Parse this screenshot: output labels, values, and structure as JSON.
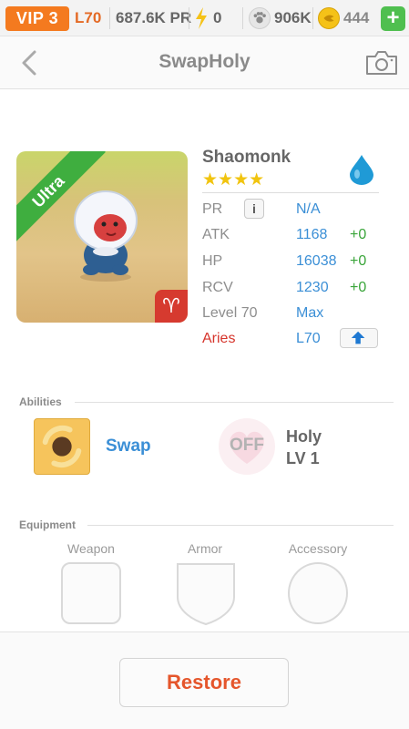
{
  "status": {
    "vip": "VIP 3",
    "level": "L70",
    "pr": "687.6K PR",
    "energy": "0",
    "paws": "906K",
    "coins": "444",
    "add": "+"
  },
  "header": {
    "title": "SwapHoly",
    "back_icon": "chevron-left-icon",
    "camera_icon": "camera-icon"
  },
  "monster": {
    "rarity": "Ultra",
    "name": "Shaomonk",
    "stars": "★★★★",
    "element_icon": "water-drop-icon",
    "zodiac_symbol": "♈",
    "stats": [
      {
        "label": "PR",
        "value": "N/A",
        "bonus": ""
      },
      {
        "label": "ATK",
        "value": "1168",
        "bonus": "+0"
      },
      {
        "label": "HP",
        "value": "16038",
        "bonus": "+0"
      },
      {
        "label": "RCV",
        "value": "1230",
        "bonus": "+0"
      },
      {
        "label": "Level 70",
        "value": "Max",
        "bonus": ""
      },
      {
        "label": "Aries",
        "value": "L70",
        "bonus": ""
      }
    ],
    "info_button": "i"
  },
  "abilities": {
    "title": "Abilities",
    "skill": {
      "name": "Swap"
    },
    "awaken": {
      "state": "OFF",
      "name": "Holy",
      "level": "LV 1"
    }
  },
  "equipment": {
    "title": "Equipment",
    "slots": [
      {
        "label": "Weapon"
      },
      {
        "label": "Armor"
      },
      {
        "label": "Accessory"
      }
    ]
  },
  "actions": {
    "restore": "Restore"
  },
  "colors": {
    "vip": "#f47a1f",
    "accent_blue": "#3b8fd6",
    "bonus_green": "#3aa53a",
    "aries_red": "#d6342b",
    "restore_red": "#e5562c",
    "ultra_green": "#3fae3f"
  }
}
